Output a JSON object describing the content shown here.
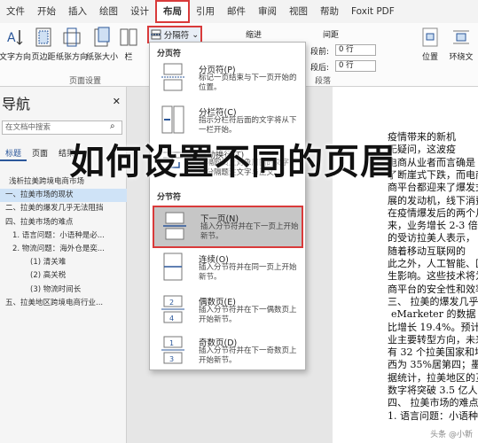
{
  "menu": [
    "文件",
    "开始",
    "插入",
    "绘图",
    "设计",
    "布局",
    "引用",
    "邮件",
    "审阅",
    "视图",
    "帮助",
    "Foxit PDF"
  ],
  "ribbon": {
    "buttons": [
      {
        "icon": "text-direction-icon",
        "label": "文字方向"
      },
      {
        "icon": "margins-icon",
        "label": "页边距"
      },
      {
        "icon": "orientation-icon",
        "label": "纸张方向"
      },
      {
        "icon": "paper-size-icon",
        "label": "纸张大小"
      },
      {
        "icon": "columns-icon",
        "label": "栏"
      }
    ],
    "breaks_label": "分隔符",
    "page_setup_label": "页面设置",
    "indent_label": "缩进",
    "spacing_label": "间距",
    "before_label": "段前:",
    "after_label": "段后:",
    "before_value": "0 行",
    "after_value": "0 行",
    "paragraph_label": "段落",
    "position_label": "位置",
    "wrap_label": "环绕文"
  },
  "nav": {
    "title": "导航",
    "search_placeholder": "在文档中搜索",
    "tabs": [
      "标题",
      "页面",
      "结果"
    ],
    "items": [
      "浅析拉美跨境电商市场",
      "一、拉美市场的现状",
      "二、拉美的爆发几乎无法阻挡",
      "四、拉美市场的难点",
      "1. 语言问题：小语种是必...",
      "2. 物流问题：海外仓是奕...",
      "(1) 清关难",
      "(2) 高关税",
      "(3) 物流时间长",
      "五、拉美地区跨境电商行业..."
    ]
  },
  "dropdown": {
    "page_breaks_header": "分页符",
    "section_breaks_header": "分节符",
    "items": [
      {
        "icon": "page-break-icon",
        "name": "分页符(P)",
        "desc": "标记一页结束与下一页开始的位置。"
      },
      {
        "icon": "column-break-icon",
        "name": "分栏符(C)",
        "desc": "指示分栏符后面的文字将从下一栏开始。"
      },
      {
        "icon": "text-wrapping-icon",
        "name": "自动换行(T)",
        "desc": "分隔网页上对象周围的文字，如分隔题注文字与正文。"
      },
      {
        "icon": "next-page-icon",
        "name": "下一页(N)",
        "desc": "插入分节符并在下一页上开始新节。"
      },
      {
        "icon": "continuous-icon",
        "name": "连续(O)",
        "desc": "插入分节符并在同一页上开始新节。"
      },
      {
        "icon": "even-page-icon",
        "name": "偶数页(E)",
        "desc": "插入分节符并在下一偶数页上开始新节。"
      },
      {
        "icon": "odd-page-icon",
        "name": "奇数页(D)",
        "desc": "插入分节符并在下一奇数页上开始新节。"
      }
    ]
  },
  "document": {
    "lines": [
      "疫情带来的新机",
      "无疑问，这波疫",
      "电商从业者而言确是",
      "了断崖式下跌，而电商",
      "商平台都迎来了爆发式",
      "展的发动机，线下消费",
      "在疫情爆发后的两个月",
      "来，业务增长 2-3 倍",
      "的受访拉美人表示，",
      "随着移动互联网的",
      "此之外，人工智能、区",
      "生影响。这些技术将为",
      "商平台的安全性和效率",
      "三、 拉美的爆发几乎",
      "eMarketer 的数据",
      "比增长 19.4%。预计到",
      "业主要转型方向，未来",
      "有 32 个拉美国家和地",
      "西为 35%居第四；墨西",
      "据统计，拉美地区的互",
      "数字将突破 3.5 亿人次",
      "四、 拉美市场的难点",
      "1. 语言问题：小语种"
    ]
  },
  "headline": "如何设置不同的页眉",
  "watermark": "头条 @小新"
}
